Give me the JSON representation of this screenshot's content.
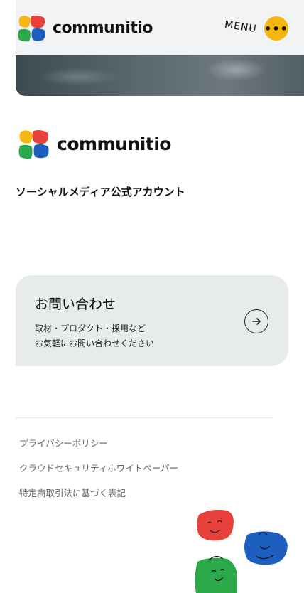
{
  "header": {
    "brand": "communitio",
    "menu_label": "MENU",
    "menu_button": "•••"
  },
  "brand_block": {
    "brand": "communitio",
    "tagline": "ソーシャルメディア公式アカウント"
  },
  "contact": {
    "title": "お問い合わせ",
    "lines": [
      "取材・プロダクト・採用など",
      "お気軽にお問い合わせください"
    ]
  },
  "footer": {
    "links": [
      "プライバシーポリシー",
      "クラウドセキュリティホワイトペーパー",
      "特定商取引法に基づく表記"
    ]
  },
  "colors": {
    "logo_red": "#e8403a",
    "logo_yellow": "#f6b712",
    "logo_green": "#2aa84a",
    "logo_blue": "#1d5fbf",
    "menu_button": "#f6b712",
    "card_bg": "#e8ebec"
  }
}
